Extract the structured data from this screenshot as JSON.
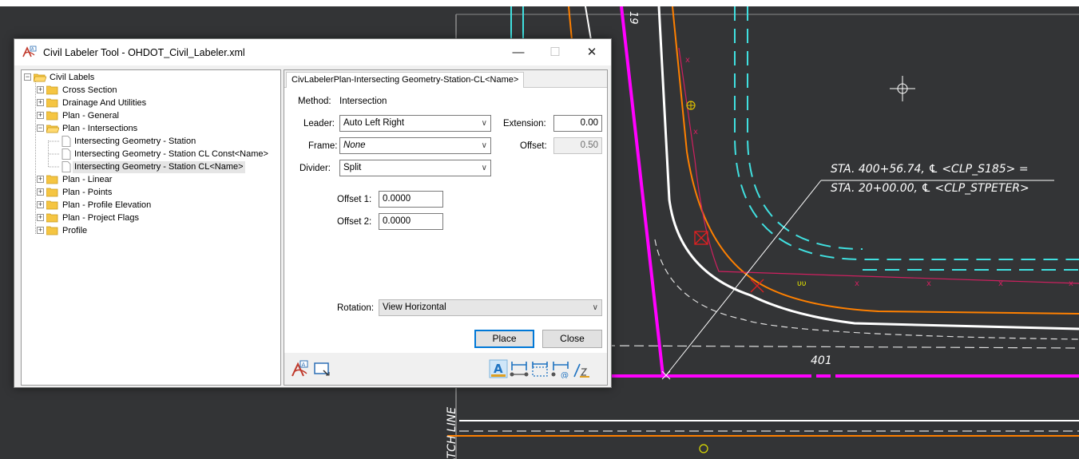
{
  "cad": {
    "station_line1": "STA. 400+56.74, ℄ <CLP_S185> =",
    "station_line2": "STA. 20+00.00, ℄ <CLP_STPETER>",
    "station_number": "401",
    "stationing_tick": "19",
    "match_line": "ATCH LINE",
    "colors": {
      "background": "#333436",
      "magenta": "#ff00ff",
      "orange": "#ff8000",
      "cyan": "#40e0e0",
      "white": "#ffffff",
      "crimson": "#d02060"
    }
  },
  "window": {
    "title": "Civil Labeler Tool - OHDOT_Civil_Labeler.xml",
    "minimize": "—",
    "maximize": "☐",
    "close": "✕"
  },
  "tree": {
    "root": "Civil Labels",
    "items": [
      {
        "label": "Cross Section"
      },
      {
        "label": "Drainage And Utilities"
      },
      {
        "label": "Plan - General"
      },
      {
        "label": "Plan - Intersections"
      },
      {
        "label": "Intersecting Geometry - Station"
      },
      {
        "label": "Intersecting Geometry - Station CL Const<Name>"
      },
      {
        "label": "Intersecting Geometry - Station CL<Name>"
      },
      {
        "label": "Plan - Linear"
      },
      {
        "label": "Plan - Points"
      },
      {
        "label": "Plan - Profile Elevation"
      },
      {
        "label": "Plan - Project Flags"
      },
      {
        "label": "Profile"
      }
    ]
  },
  "panel": {
    "tab": "CivLabelerPlan-Intersecting Geometry-Station-CL<Name>",
    "method_label": "Method:",
    "method_value": "Intersection",
    "leader_label": "Leader:",
    "leader_value": "Auto Left Right",
    "frame_label": "Frame:",
    "frame_value": "None",
    "divider_label": "Divider:",
    "divider_value": "Split",
    "extension_label": "Extension:",
    "extension_value": "0.00",
    "offset_label": "Offset:",
    "offset_value": "0.50",
    "offset1_label": "Offset 1:",
    "offset1_value": "0.0000",
    "offset2_label": "Offset 2:",
    "offset2_value": "0.0000",
    "rotation_label": "Rotation:",
    "rotation_value": "View Horizontal",
    "place_button": "Place",
    "close_button": "Close",
    "dropdown_arrow": "∨"
  }
}
